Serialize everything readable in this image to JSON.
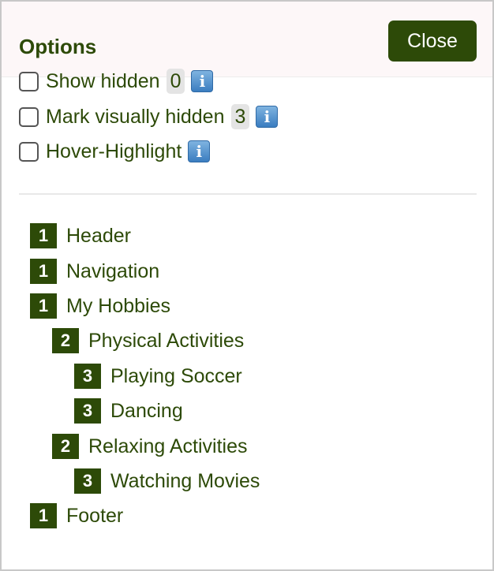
{
  "panel": {
    "title": "Options",
    "close_label": "Close"
  },
  "options": [
    {
      "label": "Show hidden",
      "checked": false,
      "count": "0",
      "info_icon": "info-icon"
    },
    {
      "label": "Mark visually hidden",
      "checked": false,
      "count": "3",
      "info_icon": "info-icon"
    },
    {
      "label": "Hover-Highlight",
      "checked": false,
      "info_icon": "info-icon"
    }
  ],
  "info_glyph": "i",
  "tree": [
    {
      "level": "1",
      "label": "Header"
    },
    {
      "level": "1",
      "label": "Navigation"
    },
    {
      "level": "1",
      "label": "My Hobbies"
    },
    {
      "level": "2",
      "label": "Physical Activities"
    },
    {
      "level": "3",
      "label": "Playing Soccer"
    },
    {
      "level": "3",
      "label": "Dancing"
    },
    {
      "level": "2",
      "label": "Relaxing Activities"
    },
    {
      "level": "3",
      "label": "Watching Movies"
    },
    {
      "level": "1",
      "label": "Footer"
    }
  ],
  "colors": {
    "accent": "#2d4a08",
    "header_background": "#fdf7f8",
    "count_background": "#e4e4e4",
    "info_blue": "#3a7dc0"
  }
}
